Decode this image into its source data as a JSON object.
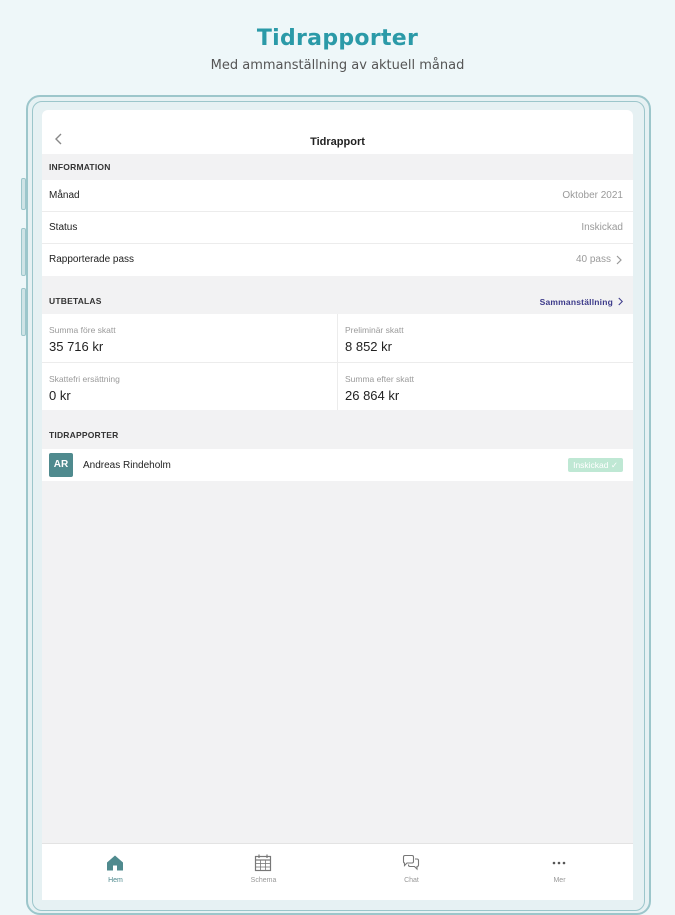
{
  "promo": {
    "title": "Tidrapporter",
    "subtitle": "Med ammanställning av aktuell månad"
  },
  "nav": {
    "title": "Tidrapport",
    "back_icon": "chevron-left-icon"
  },
  "information": {
    "header": "INFORMATION",
    "rows": [
      {
        "label": "Månad",
        "value": "Oktober 2021"
      },
      {
        "label": "Status",
        "value": "Inskickad"
      },
      {
        "label": "Rapporterade pass",
        "value": "40 pass"
      }
    ]
  },
  "utbetalas": {
    "header": "UTBETALAS",
    "link": "Sammanställning",
    "cells": [
      {
        "label": "Summa före skatt",
        "value": "35 716 kr"
      },
      {
        "label": "Preliminär skatt",
        "value": "8 852 kr"
      },
      {
        "label": "Skattefri ersättning",
        "value": "0 kr"
      },
      {
        "label": "Summa efter skatt",
        "value": "26 864 kr"
      }
    ]
  },
  "tidrapporter": {
    "header": "TIDRAPPORTER",
    "items": [
      {
        "initials": "AR",
        "name": "Andreas Rindeholm",
        "status": "Inskickad ✓"
      }
    ]
  },
  "tabs": [
    {
      "label": "Hem",
      "icon": "home-icon",
      "active": true
    },
    {
      "label": "Schema",
      "icon": "calendar-icon",
      "active": false
    },
    {
      "label": "Chat",
      "icon": "chat-icon",
      "active": false
    },
    {
      "label": "Mer",
      "icon": "more-icon",
      "active": false
    }
  ],
  "colors": {
    "accent": "#2b9aa8",
    "avatar": "#4f8a8e",
    "link": "#3c3a8a",
    "badge": "#bfe8d4"
  }
}
